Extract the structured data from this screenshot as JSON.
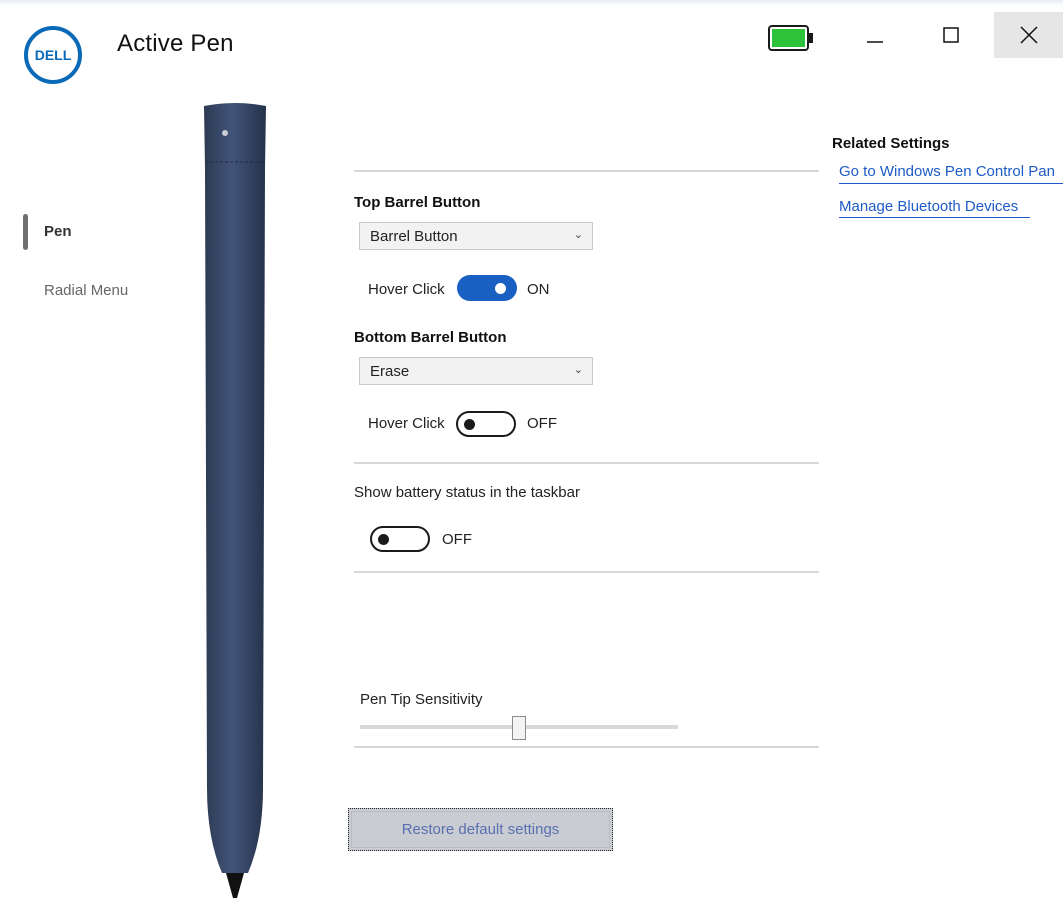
{
  "window": {
    "title": "Active Pen",
    "logo_text": "DELL",
    "battery_color": "#2ec23a",
    "minimize_symbol": "—",
    "maximize_symbol": "□",
    "close_symbol": "✕"
  },
  "nav": {
    "items": [
      {
        "label": "Pen",
        "selected": true
      },
      {
        "label": "Radial Menu",
        "selected": false
      }
    ]
  },
  "pen": {
    "body_color": "#3a4a63"
  },
  "settings": {
    "top_barrel": {
      "title": "Top Barrel Button",
      "selected": "Barrel Button",
      "hover_click_label": "Hover Click",
      "hover_click_state": "ON"
    },
    "bottom_barrel": {
      "title": "Bottom Barrel Button",
      "selected": "Erase",
      "hover_click_label": "Hover Click",
      "hover_click_state": "OFF"
    },
    "battery_status": {
      "label": "Show battery status in the taskbar",
      "state": "OFF"
    },
    "pen_tip": {
      "label": "Pen Tip Sensitivity",
      "value_fraction": 0.5
    },
    "restore_label": "Restore default settings"
  },
  "related": {
    "title": "Related Settings",
    "links": [
      "Go to Windows Pen Control Pan",
      "Manage Bluetooth Devices"
    ]
  },
  "colors": {
    "accent": "#1a5fc2",
    "link": "#1e5bc6"
  }
}
